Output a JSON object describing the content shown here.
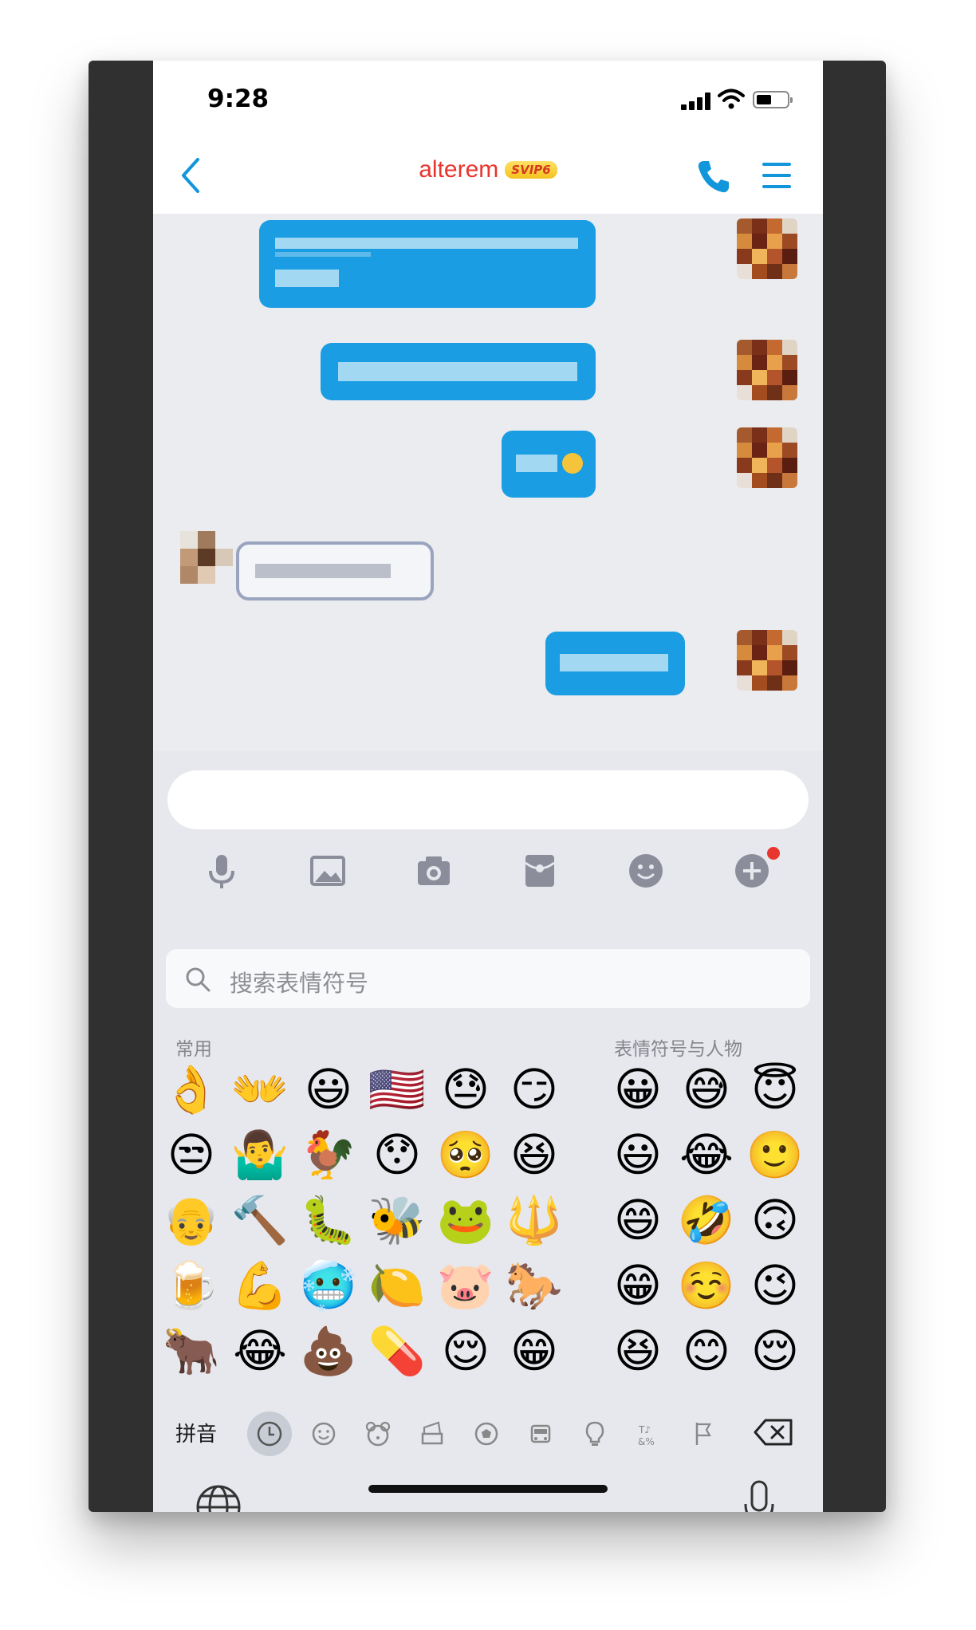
{
  "status": {
    "time": "9:28"
  },
  "header": {
    "title": "alterem",
    "vip_badge": "SVIP6"
  },
  "colors": {
    "accent": "#1296db",
    "title": "#e8352d",
    "bubble": "#1a9de2",
    "badge_bg": "#f5c21c"
  },
  "icons": {
    "back": "chevron-left-icon",
    "call": "phone-icon",
    "menu": "menu-icon",
    "toolbar": [
      "microphone-icon",
      "image-icon",
      "camera-icon",
      "red-packet-icon",
      "emoji-icon",
      "plus-icon"
    ],
    "categories": [
      "clock-icon",
      "smiley-icon",
      "animal-icon",
      "food-icon",
      "sports-icon",
      "travel-icon",
      "lightbulb-icon",
      "symbols-icon",
      "flag-icon"
    ]
  },
  "keyboard": {
    "search_placeholder": "搜索表情符号",
    "frequent_label": "常用",
    "people_label": "表情符号与人物",
    "pinyin_key": "拼音",
    "frequent": [
      [
        "👌",
        "👐",
        "😃",
        "🇺🇸",
        "😓",
        "😏"
      ],
      [
        "😒",
        "🤷‍♂️",
        "🐓",
        "😯",
        "🥺",
        "😆"
      ],
      [
        "👴",
        "🔨",
        "🐛",
        "🐝",
        "🐸",
        "🔱"
      ],
      [
        "🍺",
        "💪",
        "🥶",
        "🍋",
        "🐷",
        "🐎"
      ],
      [
        "🐂",
        "😂",
        "💩",
        "💊",
        "😌",
        "😁"
      ]
    ],
    "people": [
      [
        "😀",
        "😅",
        "😇"
      ],
      [
        "😃",
        "😂",
        "🙂"
      ],
      [
        "😄",
        "🤣",
        "🙃"
      ],
      [
        "😁",
        "☺️",
        "😉"
      ],
      [
        "😆",
        "😊",
        "😌"
      ]
    ]
  }
}
